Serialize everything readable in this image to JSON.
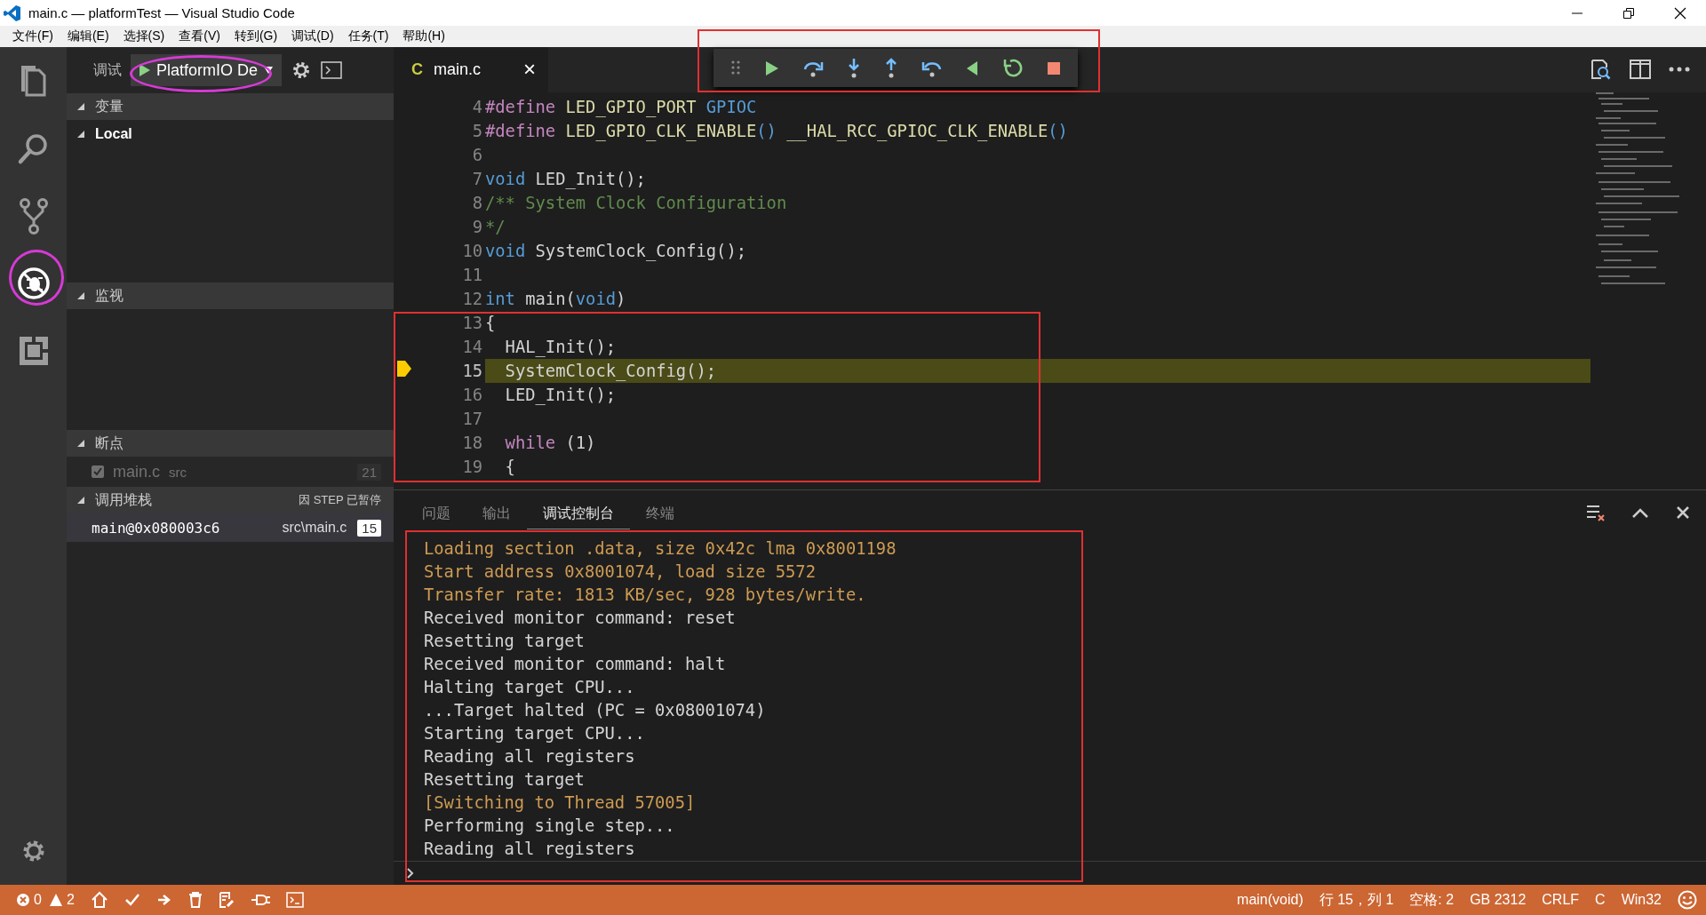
{
  "window": {
    "title": "main.c — platformTest — Visual Studio Code"
  },
  "menu": [
    "文件(F)",
    "编辑(E)",
    "选择(S)",
    "查看(V)",
    "转到(G)",
    "调试(D)",
    "任务(T)",
    "帮助(H)"
  ],
  "activity_bar": [
    {
      "kind": "files",
      "selected": false
    },
    {
      "kind": "search",
      "selected": false
    },
    {
      "kind": "scm",
      "selected": false
    },
    {
      "kind": "debug",
      "selected": true
    },
    {
      "kind": "extensions",
      "selected": false
    }
  ],
  "sidebar": {
    "title": "调试",
    "configuration": "PlatformIO De",
    "variables": {
      "title": "变量",
      "expanded": true,
      "scopes": [
        {
          "label": "Local",
          "expanded": true
        }
      ]
    },
    "watch": {
      "title": "监视",
      "expanded": true
    },
    "breakpoints": {
      "title": "断点",
      "expanded": true,
      "items": [
        {
          "file": "main.c",
          "path": "src",
          "line": "21",
          "checked": true,
          "unverified": true
        }
      ]
    },
    "call_stack": {
      "title": "调用堆栈",
      "expanded": true,
      "status": "因 STEP 已暂停",
      "frames": [
        {
          "name": "main@0x080003c6",
          "file": "src\\main.c",
          "line": "15",
          "selected": true
        }
      ]
    }
  },
  "editor": {
    "tabs": [
      {
        "label": "main.c",
        "icon": "C",
        "close": "×",
        "selected": true
      }
    ],
    "lines": [
      {
        "number": "4",
        "current": false,
        "tokens": [
          {
            "kind": "macro",
            "text": "#define"
          },
          {
            "kind": "func",
            "text": " LED_GPIO_PORT "
          },
          {
            "kind": "keyword",
            "text": "GPIOC"
          }
        ]
      },
      {
        "number": "5",
        "current": false,
        "tokens": [
          {
            "kind": "macro",
            "text": "#define"
          },
          {
            "kind": "func",
            "text": " LED_GPIO_CLK_ENABLE"
          },
          {
            "kind": "keyword",
            "text": "()"
          },
          {
            "kind": "func",
            "text": " __HAL_RCC_GPIOC_CLK_ENABLE"
          },
          {
            "kind": "keyword",
            "text": "()"
          }
        ]
      },
      {
        "number": "6",
        "current": false
      },
      {
        "number": "7",
        "current": false,
        "tokens": [
          {
            "kind": "keyword",
            "text": "void"
          },
          {
            "kind": "plain",
            "text": " LED_Init();"
          }
        ]
      },
      {
        "number": "8",
        "current": false,
        "tokens": [
          {
            "kind": "comment",
            "text": "/** System Clock Configuration"
          }
        ]
      },
      {
        "number": "9",
        "current": false,
        "tokens": [
          {
            "kind": "comment",
            "text": "*/"
          }
        ]
      },
      {
        "number": "10",
        "current": false,
        "tokens": [
          {
            "kind": "keyword",
            "text": "void"
          },
          {
            "kind": "plain",
            "text": " SystemClock_Config();"
          }
        ]
      },
      {
        "number": "11",
        "current": false
      },
      {
        "number": "12",
        "current": false,
        "tokens": [
          {
            "kind": "keyword",
            "text": "int"
          },
          {
            "kind": "plain",
            "text": " main("
          },
          {
            "kind": "keyword",
            "text": "void"
          },
          {
            "kind": "plain",
            "text": ")"
          }
        ]
      },
      {
        "number": "13",
        "current": false,
        "tokens": [
          {
            "kind": "plain",
            "text": "{"
          }
        ]
      },
      {
        "number": "14",
        "current": false,
        "tokens": [
          {
            "kind": "plain",
            "text": "  HAL_Init();"
          }
        ]
      },
      {
        "number": "15",
        "current": true,
        "tokens": [
          {
            "kind": "plain",
            "text": "  SystemClock_Config();"
          }
        ]
      },
      {
        "number": "16",
        "current": false,
        "tokens": [
          {
            "kind": "plain",
            "text": "  LED_Init();"
          }
        ]
      },
      {
        "number": "17",
        "current": false
      },
      {
        "number": "18",
        "current": false,
        "tokens": [
          {
            "kind": "control",
            "text": "  while"
          },
          {
            "kind": "plain",
            "text": " (1)"
          }
        ]
      },
      {
        "number": "19",
        "current": false,
        "tokens": [
          {
            "kind": "plain",
            "text": "  {"
          }
        ]
      }
    ]
  },
  "panel": {
    "tabs": [
      {
        "label": "问题",
        "selected": false
      },
      {
        "label": "输出",
        "selected": false
      },
      {
        "label": "调试控制台",
        "selected": true
      },
      {
        "label": "终端",
        "selected": false
      }
    ],
    "console": [
      {
        "kind": "info",
        "text": "Loading section .data, size 0x42c lma 0x8001198"
      },
      {
        "kind": "info",
        "text": "Start address 0x8001074, load size 5572"
      },
      {
        "kind": "info",
        "text": "Transfer rate: 1813 KB/sec, 928 bytes/write."
      },
      {
        "kind": "plain",
        "text": "Received monitor command: reset"
      },
      {
        "kind": "plain",
        "text": "Resetting target"
      },
      {
        "kind": "plain",
        "text": "Received monitor command: halt"
      },
      {
        "kind": "plain",
        "text": "Halting target CPU..."
      },
      {
        "kind": "plain",
        "text": "...Target halted (PC = 0x08001074)"
      },
      {
        "kind": "plain",
        "text": "Starting target CPU..."
      },
      {
        "kind": "plain",
        "text": "Reading all registers"
      },
      {
        "kind": "plain",
        "text": "Resetting target"
      },
      {
        "kind": "info",
        "text": "[Switching to Thread 57005]"
      },
      {
        "kind": "plain",
        "text": "Performing single step..."
      },
      {
        "kind": "plain",
        "text": "Reading all registers"
      }
    ]
  },
  "status_bar": {
    "errors": "0",
    "warnings": "2",
    "right": [
      "main(void)",
      "行 15，列 1",
      "空格: 2",
      "GB 2312",
      "CRLF",
      "C",
      "Win32"
    ]
  }
}
